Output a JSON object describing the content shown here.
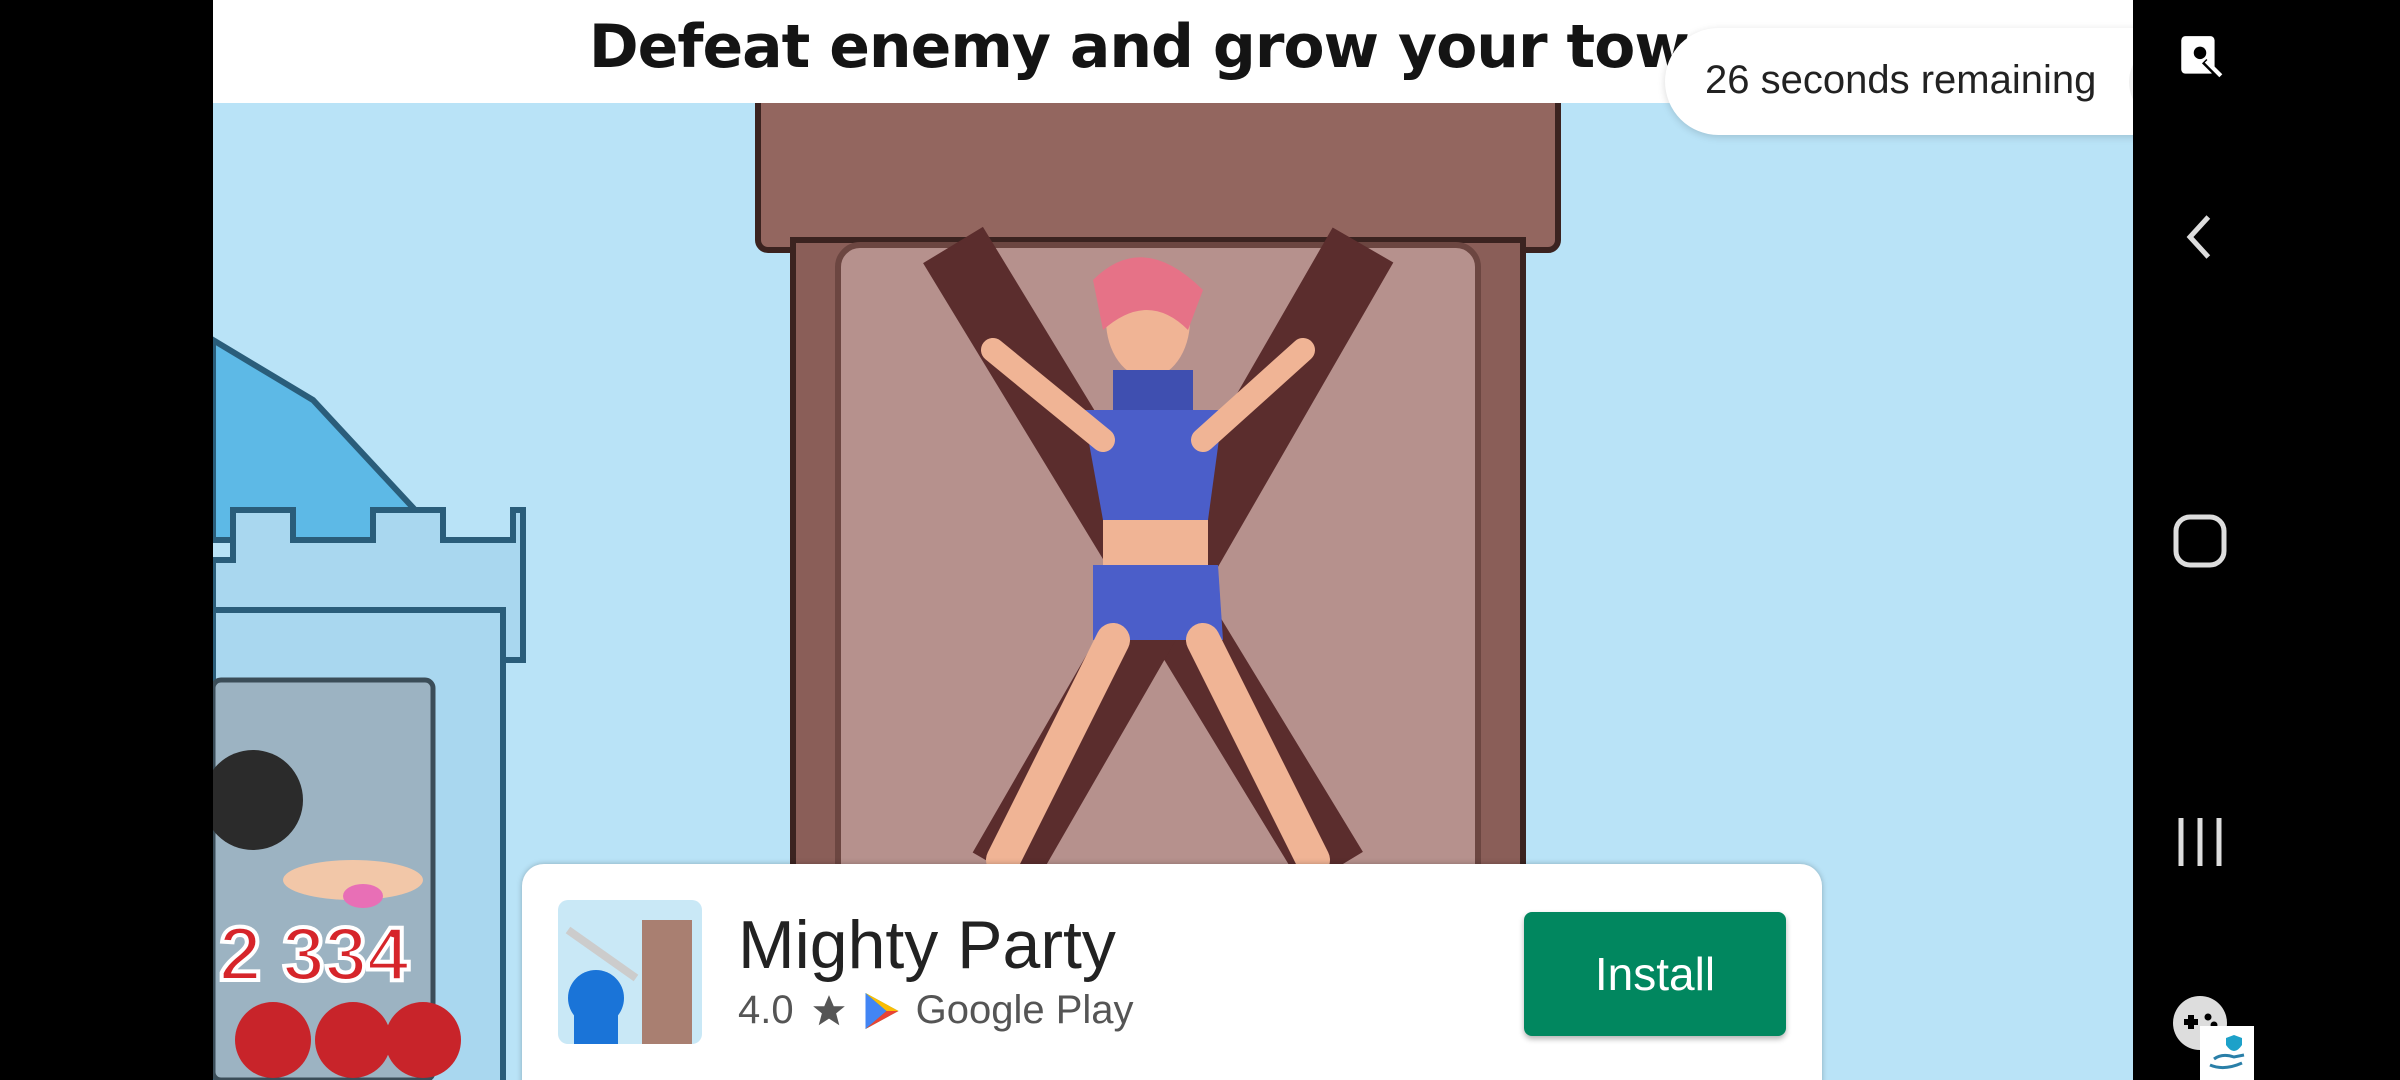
{
  "ad": {
    "headline": "Defeat enemy and grow your tower",
    "timer": "26 seconds remaining",
    "app_name": "Mighty Party",
    "rating": "4.0",
    "store": "Google Play",
    "install_label": "Install",
    "score_text": "2 334"
  },
  "colors": {
    "sky": "#b9e3f7",
    "tower": "#8b5a54",
    "install": "#01875f"
  },
  "icons": {
    "mute": "speaker-muted-icon",
    "close": "close-icon",
    "star": "star-icon",
    "play": "google-play-icon",
    "back": "back-icon",
    "home": "home-icon",
    "recents": "recents-icon",
    "game": "game-launcher-icon",
    "screen": "screen-record-icon",
    "privacy": "ad-choices-icon"
  }
}
